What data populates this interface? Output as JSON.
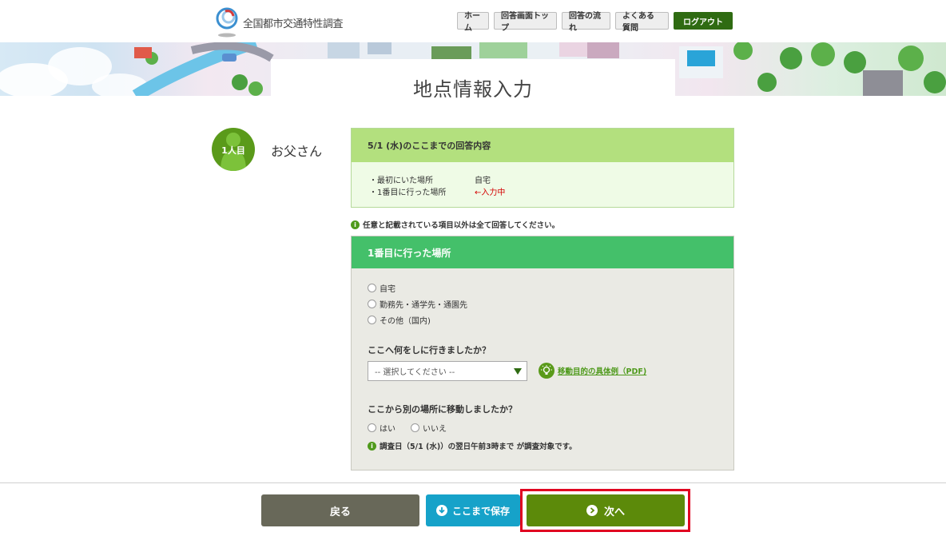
{
  "header": {
    "logo_text": "全国都市交通特性調査",
    "nav": [
      {
        "label": "ホーム"
      },
      {
        "label": "回答画面トップ"
      },
      {
        "label": "回答の流れ"
      },
      {
        "label": "よくある質問"
      }
    ],
    "logout_label": "ログアウト"
  },
  "page": {
    "title": "地点情報入力"
  },
  "person": {
    "badge": "1人目",
    "name": "お父さん"
  },
  "summary": {
    "title": "5/1 (水)のここまでの回答内容",
    "rows": [
      {
        "label": "・最初にいた場所",
        "value": "自宅"
      },
      {
        "label": "・1番目に行った場所",
        "value": "←入力中"
      }
    ]
  },
  "notice": "任意と記載されている項目以外は全て回答してください。",
  "form": {
    "title": "1番目に行った場所",
    "place_options": [
      "自宅",
      "勤務先・通学先・通園先",
      "その他（国内)"
    ],
    "purpose_question": "ここへ何をしに行きましたか？",
    "purpose_placeholder": "-- 選択してください --",
    "purpose_link": "移動目的の具体例（PDF)",
    "move_question": "ここから別の場所に移動しましたか？",
    "yes_label": "はい",
    "no_label": "いいえ",
    "note": "調査日（5/1 (水)）の翌日午前3時まで が調査対象です。"
  },
  "footer": {
    "back_label": "戻る",
    "save_label": "ここまで保存",
    "next_label": "次へ"
  },
  "colors": {
    "accent_green": "#5c8a0a",
    "form_header": "#44c06a",
    "summary_header": "#b3e07e",
    "save_blue": "#16a2c9",
    "highlight_red": "#e00020"
  }
}
